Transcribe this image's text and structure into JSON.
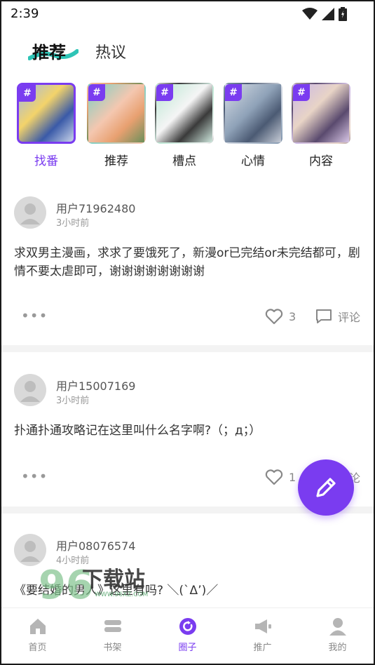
{
  "status": {
    "time": "2:39"
  },
  "tabs": [
    {
      "label": "推荐",
      "active": true
    },
    {
      "label": "热议",
      "active": false
    }
  ],
  "topics": [
    {
      "label": "找番",
      "hash": "#",
      "active": true
    },
    {
      "label": "推荐",
      "hash": "#",
      "active": false
    },
    {
      "label": "槽点",
      "hash": "#",
      "active": false
    },
    {
      "label": "心情",
      "hash": "#",
      "active": false
    },
    {
      "label": "内容",
      "hash": "#",
      "active": false
    }
  ],
  "posts": [
    {
      "user": "用户71962480",
      "time": "3小时前",
      "text": "求双男主漫画，求求了要饿死了，新漫or已完结or未完结都可，剧情不要太虐即可，谢谢谢谢谢谢谢谢",
      "likes": "3",
      "comment_label": "评论"
    },
    {
      "user": "用户15007169",
      "time": "3小时前",
      "text": "扑通扑通攻略记在这里叫什么名字啊?（；д；）",
      "likes": "1",
      "comment_label": "评论"
    },
    {
      "user": "用户08076574",
      "time": "4小时前",
      "text": "《要结婚的男人》这里有吗? ＼(`Δ’)／"
    }
  ],
  "more_glyph": "•••",
  "watermark": {
    "text": "下载站",
    "site": "WWW.96XZ.COM"
  },
  "nav": [
    {
      "label": "首页",
      "icon": "home-icon",
      "active": false
    },
    {
      "label": "书架",
      "icon": "bookshelf-icon",
      "active": false
    },
    {
      "label": "圈子",
      "icon": "circle-icon",
      "active": true
    },
    {
      "label": "推广",
      "icon": "megaphone-icon",
      "active": false
    },
    {
      "label": "我的",
      "icon": "profile-icon",
      "active": false
    }
  ],
  "colors": {
    "accent": "#7a3cf0",
    "tab_underline": "#2ec4b6"
  }
}
